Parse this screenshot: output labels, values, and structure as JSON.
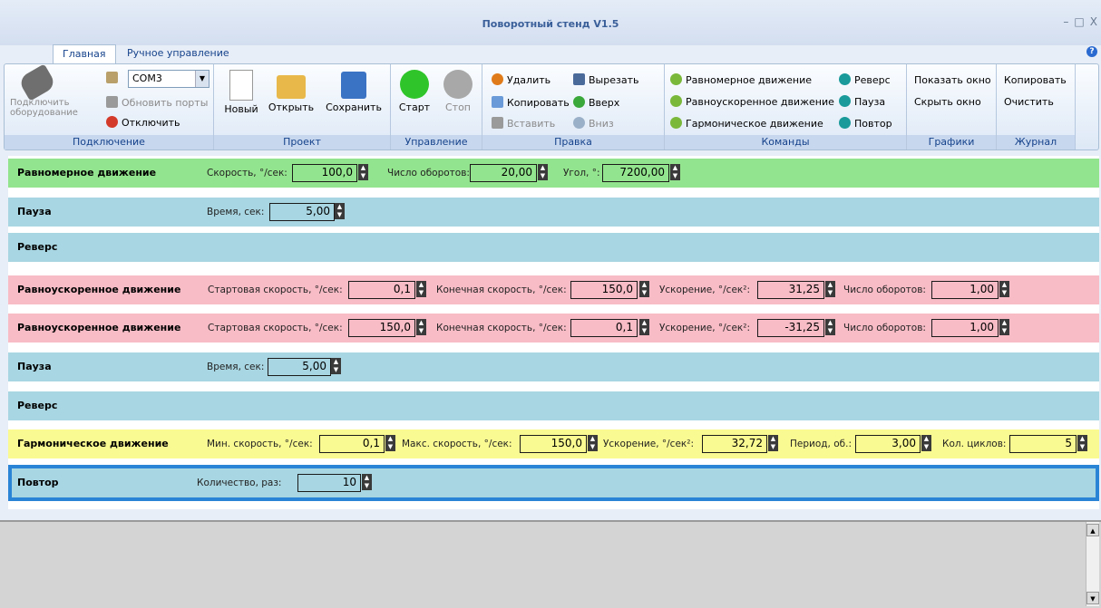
{
  "window": {
    "title": "Поворотный стенд V1.5",
    "controls": [
      "–",
      "□",
      "X"
    ]
  },
  "tabs": [
    {
      "label": "Главная"
    },
    {
      "label": "Ручное управление"
    }
  ],
  "ribbon": {
    "connection": {
      "group_label": "Подключение",
      "connect_label": "Подключить оборудование",
      "port_value": "COM3",
      "refresh_label": "Обновить порты",
      "disconnect_label": "Отключить"
    },
    "project": {
      "group_label": "Проект",
      "new_label": "Новый",
      "open_label": "Открыть",
      "save_label": "Сохранить"
    },
    "control": {
      "group_label": "Управление",
      "start_label": "Старт",
      "stop_label": "Стоп"
    },
    "edit": {
      "group_label": "Правка",
      "delete_label": "Удалить",
      "copy_label": "Копировать",
      "paste_label": "Вставить",
      "cut_label": "Вырезать",
      "up_label": "Вверх",
      "down_label": "Вниз"
    },
    "commands": {
      "group_label": "Команды",
      "uniform_label": "Равномерное движение",
      "accel_label": "Равноускоренное движение",
      "harmonic_label": "Гармоническое движение",
      "reverse_label": "Реверс",
      "pause_label": "Пауза",
      "repeat_label": "Повтор"
    },
    "graphs": {
      "group_label": "Графики",
      "show_label": "Показать окно",
      "hide_label": "Скрыть окно"
    },
    "log": {
      "group_label": "Журнал",
      "copy_label": "Копировать",
      "clear_label": "Очистить"
    }
  },
  "colors": {
    "uniform": "#93e48e",
    "pause": "#a8d6e2",
    "accel": "#f8bcc6",
    "harmonic": "#fafa92",
    "selected": "#2a84d6"
  },
  "rows": [
    {
      "name": "Равномерное движение",
      "fields": [
        {
          "label": "Скорость, °/сек:",
          "value": "100,0"
        },
        {
          "label": "Число оборотов:",
          "value": "20,00"
        },
        {
          "label": "Угол, °:",
          "value": "7200,00"
        }
      ]
    },
    {
      "name": "Пауза",
      "fields": [
        {
          "label": "Время, сек:",
          "value": "5,00"
        }
      ]
    },
    {
      "name": "Реверс",
      "fields": []
    },
    {
      "name": "Равноускоренное движение",
      "fields": [
        {
          "label": "Стартовая скорость, °/сек:",
          "value": "0,1"
        },
        {
          "label": "Конечная скорость, °/сек:",
          "value": "150,0"
        },
        {
          "label": "Ускорение, °/сек²:",
          "value": "31,25"
        },
        {
          "label": "Число оборотов:",
          "value": "1,00"
        }
      ]
    },
    {
      "name": "Равноускоренное движение",
      "fields": [
        {
          "label": "Стартовая скорость, °/сек:",
          "value": "150,0"
        },
        {
          "label": "Конечная скорость, °/сек:",
          "value": "0,1"
        },
        {
          "label": "Ускорение, °/сек²:",
          "value": "-31,25"
        },
        {
          "label": "Число оборотов:",
          "value": "1,00"
        }
      ]
    },
    {
      "name": "Пауза",
      "fields": [
        {
          "label": "Время, сек:",
          "value": "5,00"
        }
      ]
    },
    {
      "name": "Реверс",
      "fields": []
    },
    {
      "name": "Гармоническое движение",
      "fields": [
        {
          "label": "Мин. скорость, °/сек:",
          "value": "0,1"
        },
        {
          "label": "Макс. скорость, °/сек:",
          "value": "150,0"
        },
        {
          "label": "Ускорение, °/сек²:",
          "value": "32,72"
        },
        {
          "label": "Период, об.:",
          "value": "3,00"
        },
        {
          "label": "Кол. циклов:",
          "value": "5"
        }
      ]
    },
    {
      "name": "Повтор",
      "fields": [
        {
          "label": "Количество, раз:",
          "value": "10"
        }
      ]
    }
  ]
}
